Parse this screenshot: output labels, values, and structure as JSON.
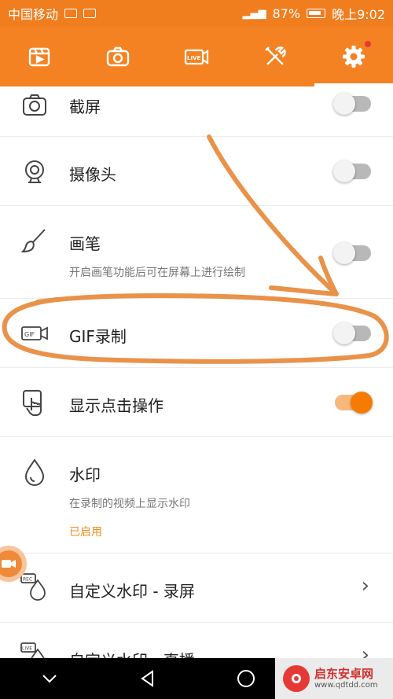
{
  "status_bar": {
    "carrier": "中国移动",
    "battery": "87%",
    "time": "晚上9:02"
  },
  "toolbar": {
    "tabs": [
      {
        "icon": "video-clip-icon",
        "active": false
      },
      {
        "icon": "camera-icon",
        "active": false
      },
      {
        "icon": "live-camera-icon",
        "active": false
      },
      {
        "icon": "tools-icon",
        "active": false
      },
      {
        "icon": "gear-icon",
        "active": true,
        "badge": true
      }
    ]
  },
  "settings": [
    {
      "id": "screenshot",
      "title": "截屏",
      "icon": "camera-icon",
      "switch": false
    },
    {
      "id": "webcam",
      "title": "摄像头",
      "icon": "webcam-icon",
      "switch": false
    },
    {
      "id": "brush",
      "title": "画笔",
      "subtitle": "开启画笔功能后可在屏幕上进行绘制",
      "icon": "brush-icon",
      "switch": false
    },
    {
      "id": "gif",
      "title": "GIF录制",
      "icon": "gif-camera-icon",
      "switch": false
    },
    {
      "id": "touch",
      "title": "显示点击操作",
      "icon": "touch-icon",
      "switch": true
    },
    {
      "id": "watermark",
      "title": "水印",
      "subtitle": "在录制的视频上显示水印",
      "status": "已启用",
      "icon": "water-drop-icon"
    },
    {
      "id": "custom-wm-rec",
      "title": "自定义水印 - 录屏",
      "icon": "rec-drop-icon"
    },
    {
      "id": "custom-wm-live",
      "title": "自定义水印 - 直播",
      "icon": "live-drop-icon"
    }
  ],
  "watermark_logo": {
    "name": "启东安卓网",
    "url": "www.qdtdd.com"
  },
  "colors": {
    "accent": "#f48222",
    "switch_on": "#f57c00",
    "annotation": "#e8893a"
  }
}
